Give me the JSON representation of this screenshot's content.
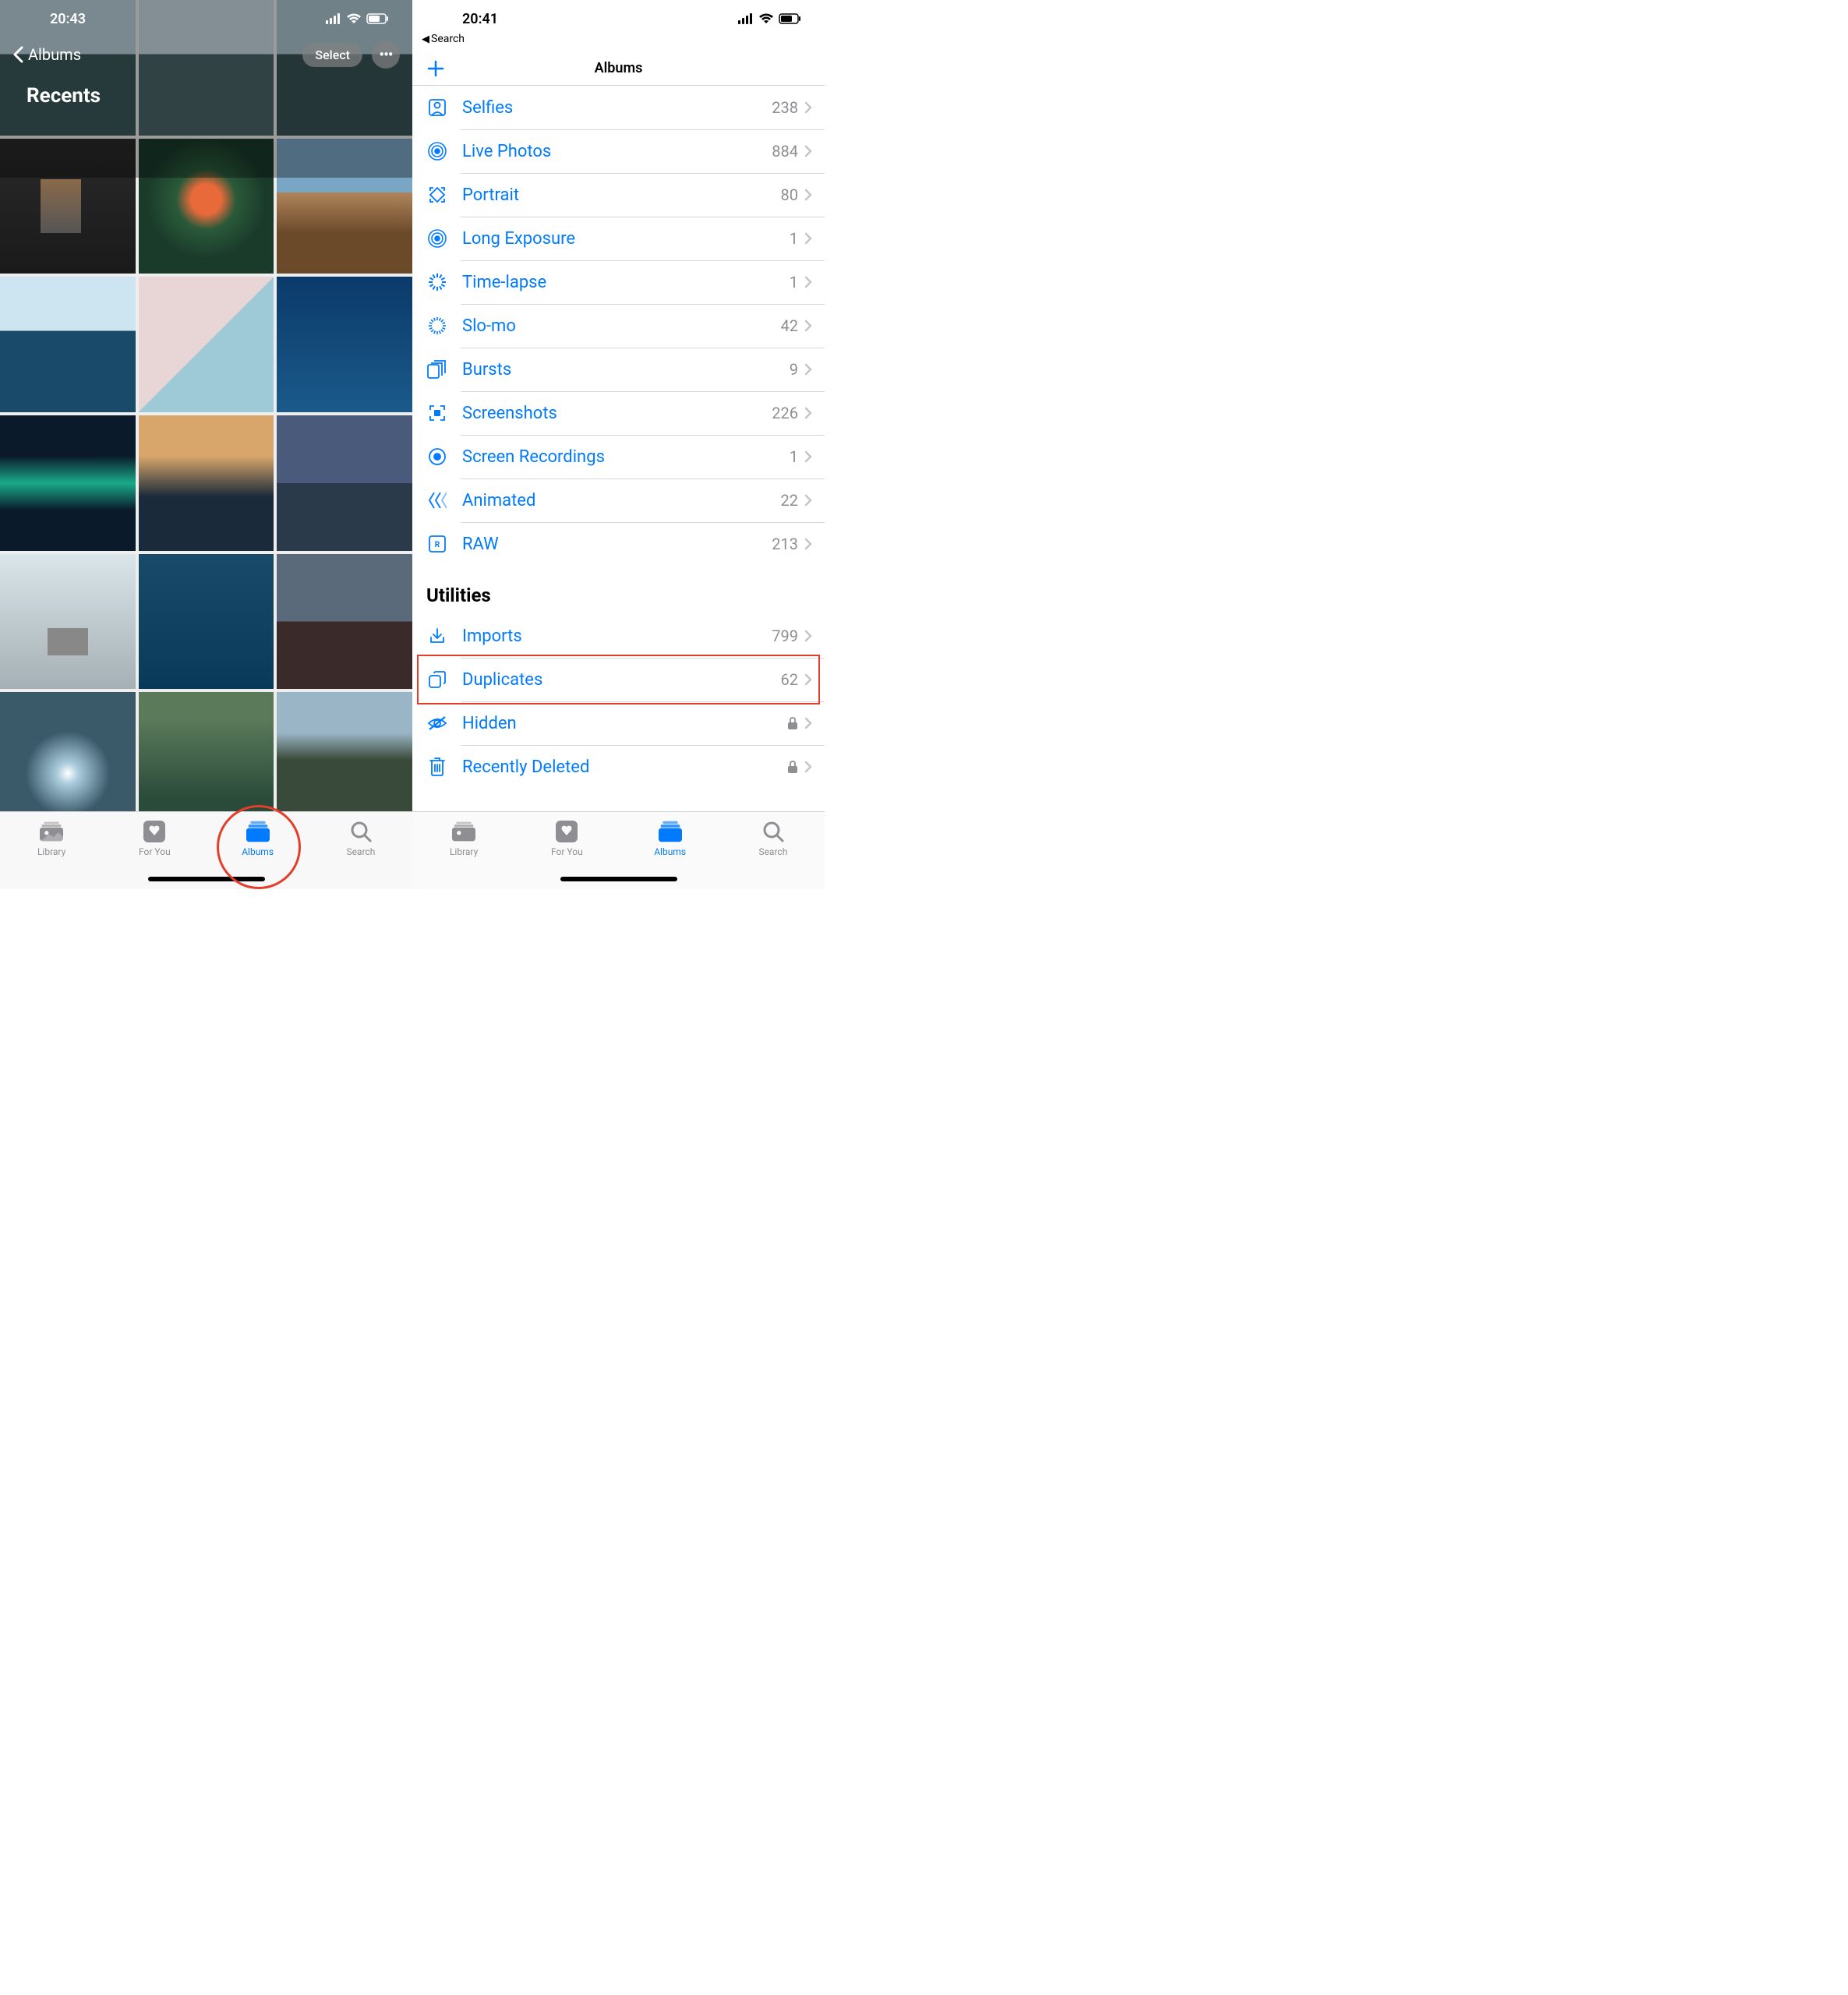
{
  "left": {
    "time": "20:43",
    "back_label": "Albums",
    "title": "Recents",
    "select_label": "Select",
    "tabs": {
      "library": "Library",
      "for_you": "For You",
      "albums": "Albums",
      "search": "Search"
    }
  },
  "right": {
    "time": "20:41",
    "back_link": "Search",
    "nav_title": "Albums",
    "media_types": [
      {
        "icon": "selfies",
        "label": "Selfies",
        "count": "238"
      },
      {
        "icon": "live",
        "label": "Live Photos",
        "count": "884"
      },
      {
        "icon": "portrait",
        "label": "Portrait",
        "count": "80"
      },
      {
        "icon": "longexp",
        "label": "Long Exposure",
        "count": "1"
      },
      {
        "icon": "timelapse",
        "label": "Time-lapse",
        "count": "1"
      },
      {
        "icon": "slomo",
        "label": "Slo-mo",
        "count": "42"
      },
      {
        "icon": "bursts",
        "label": "Bursts",
        "count": "9"
      },
      {
        "icon": "screenshot",
        "label": "Screenshots",
        "count": "226"
      },
      {
        "icon": "screenrec",
        "label": "Screen Recordings",
        "count": "1"
      },
      {
        "icon": "animated",
        "label": "Animated",
        "count": "22"
      },
      {
        "icon": "raw",
        "label": "RAW",
        "count": "213"
      }
    ],
    "utilities_header": "Utilities",
    "utilities": [
      {
        "icon": "imports",
        "label": "Imports",
        "count": "799",
        "locked": false,
        "highlight": false
      },
      {
        "icon": "duplicates",
        "label": "Duplicates",
        "count": "62",
        "locked": false,
        "highlight": true
      },
      {
        "icon": "hidden",
        "label": "Hidden",
        "count": "",
        "locked": true,
        "highlight": false
      },
      {
        "icon": "trash",
        "label": "Recently Deleted",
        "count": "",
        "locked": true,
        "highlight": false
      }
    ],
    "tabs": {
      "library": "Library",
      "for_you": "For You",
      "albums": "Albums",
      "search": "Search"
    }
  }
}
